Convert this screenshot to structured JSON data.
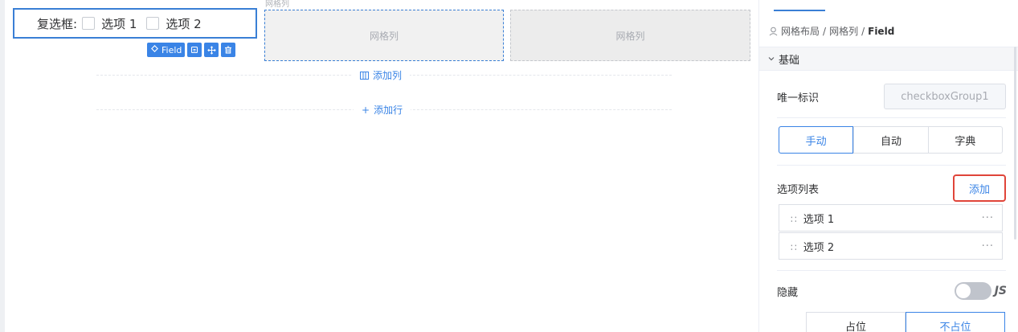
{
  "canvas": {
    "grid_caption": "网格列",
    "field": {
      "label": "复选框:",
      "options": [
        "选项 1",
        "选项 2"
      ],
      "toolbar_field_label": "Field"
    },
    "columns": [
      "网格列",
      "网格列"
    ],
    "add_column_label": "添加列",
    "add_row_label": "添加行"
  },
  "panel": {
    "breadcrumb": [
      "网格布局",
      "网格列",
      "Field"
    ],
    "section_title": "基础",
    "unique_id_label": "唯一标识",
    "unique_id_value": "checkboxGroup1",
    "source_modes": [
      "手动",
      "自动",
      "字典"
    ],
    "source_mode_selected": "手动",
    "options_list_label": "选项列表",
    "add_option_label": "添加",
    "option_items": [
      "选项 1",
      "选项 2"
    ],
    "hidden_label": "隐藏",
    "hidden_enabled": false,
    "js_label": "JS",
    "placeholder_modes": [
      "占位",
      "不占位"
    ],
    "placeholder_selected": "不占位"
  },
  "colors": {
    "accent": "#3a84e6",
    "selection_border": "#3a7fd5",
    "highlight_red": "#e0453a"
  }
}
